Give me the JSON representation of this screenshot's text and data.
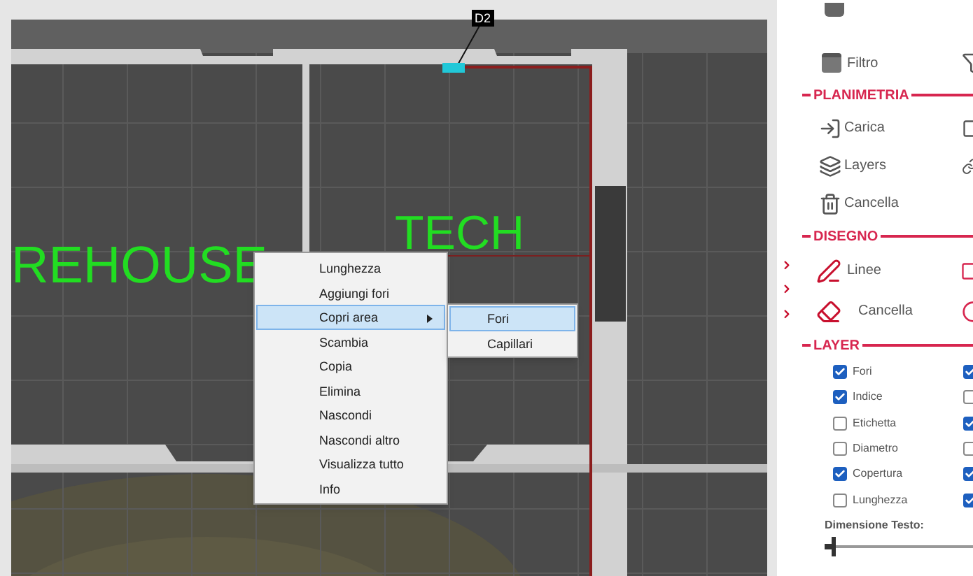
{
  "canvas": {
    "tag": "D2",
    "labels": [
      {
        "text": "REHOUSE"
      },
      {
        "text": "TECH"
      }
    ]
  },
  "context_menu": {
    "items": [
      {
        "label": "Lunghezza",
        "selected": false
      },
      {
        "label": "Aggiungi fori",
        "selected": false
      },
      {
        "label": "Copri area",
        "selected": true,
        "has_submenu": true
      },
      {
        "label": "Scambia",
        "selected": false
      },
      {
        "label": "Copia",
        "selected": false
      },
      {
        "label": "Elimina",
        "selected": false
      },
      {
        "label": "Nascondi",
        "selected": false
      },
      {
        "label": "Nascondi altro",
        "selected": false
      },
      {
        "label": "Visualizza tutto",
        "selected": false
      },
      {
        "label": "Info",
        "selected": false
      }
    ]
  },
  "submenu": {
    "items": [
      {
        "label": "Fori",
        "selected": true
      },
      {
        "label": "Capillari",
        "selected": false
      }
    ]
  },
  "panel": {
    "top_item": {
      "label": "Filtro"
    },
    "planimetria": {
      "title": "PLANIMETRIA",
      "items": [
        {
          "label": "Carica",
          "kind": "load"
        },
        {
          "label": "Layers",
          "kind": "layers"
        },
        {
          "label": "Cancella",
          "kind": "trash"
        }
      ]
    },
    "disegno": {
      "title": "DISEGNO",
      "items": [
        {
          "label": "Linee",
          "kind": "pen"
        },
        {
          "label": "Cancella",
          "kind": "eraser"
        }
      ]
    },
    "layer": {
      "title": "LAYER",
      "rows": [
        {
          "label": "Fori",
          "checked": true,
          "second_checked": true
        },
        {
          "label": "Indice",
          "checked": true,
          "second_checked": false
        },
        {
          "label": "Etichetta",
          "checked": false,
          "second_checked": true
        },
        {
          "label": "Diametro",
          "checked": false,
          "second_checked": false
        },
        {
          "label": "Copertura",
          "checked": true,
          "second_checked": true
        },
        {
          "label": "Lunghezza",
          "checked": false,
          "second_checked": true
        }
      ],
      "text_size": {
        "label": "Dimensione Testo:",
        "level": 0.05
      }
    }
  }
}
